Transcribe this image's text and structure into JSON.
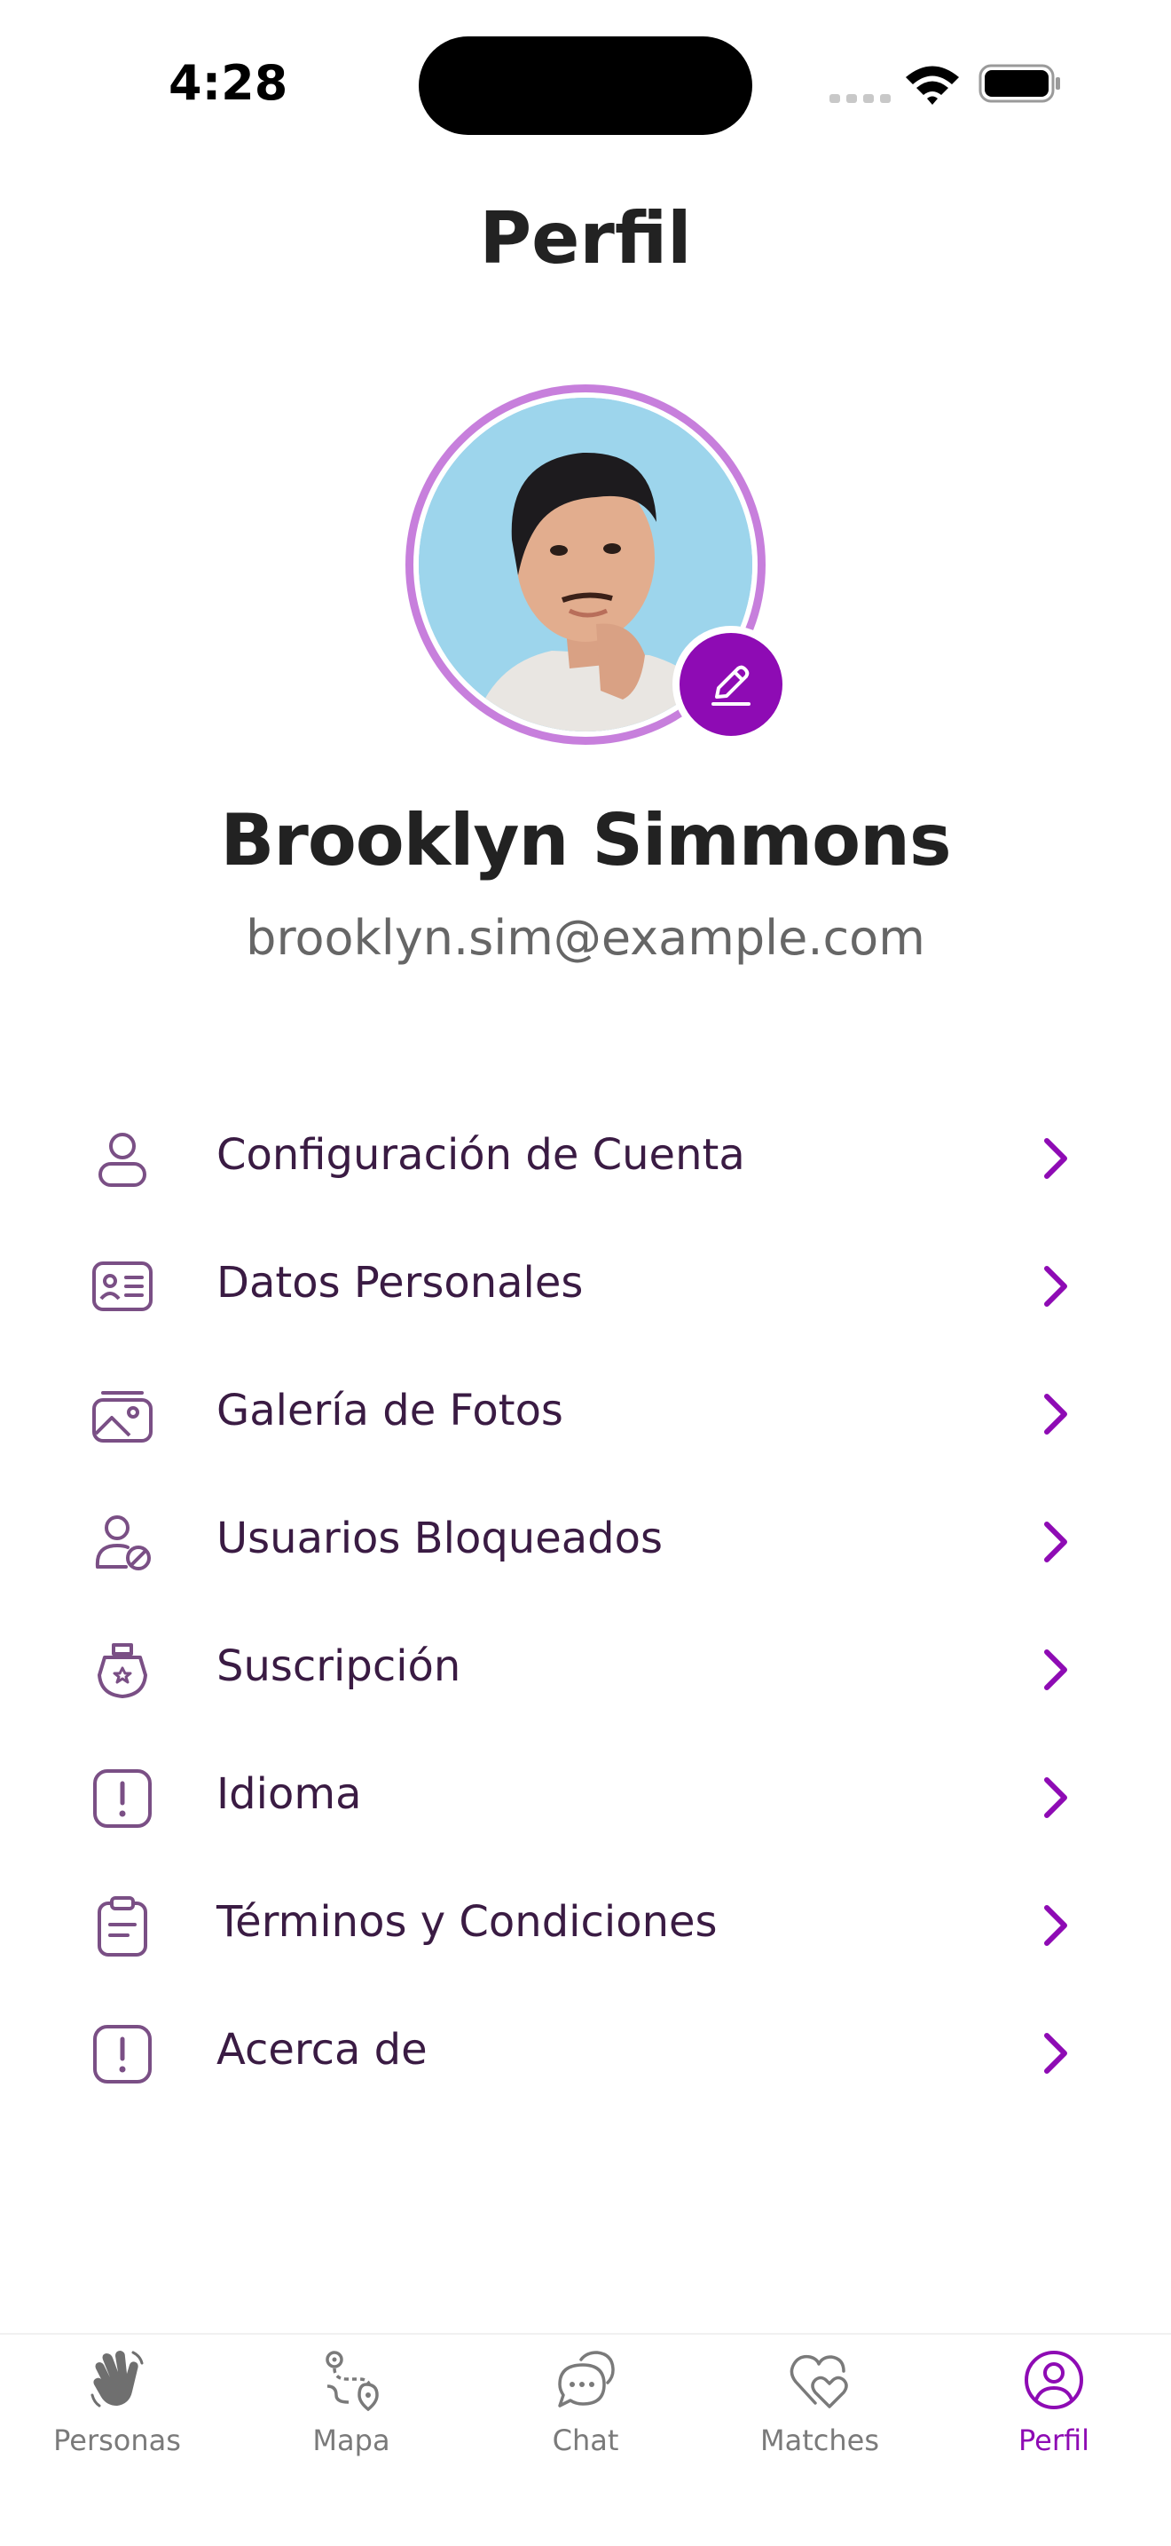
{
  "status_bar": {
    "time": "4:28"
  },
  "header": {
    "title": "Perfil"
  },
  "profile": {
    "name": "Brooklyn Simmons",
    "email": "brooklyn.sim@example.com"
  },
  "menu": [
    {
      "label": "Configuración de Cuenta",
      "icon": "user-icon"
    },
    {
      "label": "Datos Personales",
      "icon": "id-card-icon"
    },
    {
      "label": "Galería de Fotos",
      "icon": "gallery-icon"
    },
    {
      "label": "Usuarios Bloqueados",
      "icon": "user-blocked-icon"
    },
    {
      "label": "Suscripción",
      "icon": "subscription-icon"
    },
    {
      "label": "Idioma",
      "icon": "alert-icon"
    },
    {
      "label": "Términos y Condiciones",
      "icon": "clipboard-icon"
    },
    {
      "label": "Acerca de",
      "icon": "alert-icon"
    }
  ],
  "bottom_nav": [
    {
      "label": "Personas",
      "icon": "wave-hand-icon",
      "active": false
    },
    {
      "label": "Mapa",
      "icon": "route-icon",
      "active": false
    },
    {
      "label": "Chat",
      "icon": "chat-icon",
      "active": false
    },
    {
      "label": "Matches",
      "icon": "hearts-icon",
      "active": false
    },
    {
      "label": "Perfil",
      "icon": "profile-icon",
      "active": true
    }
  ],
  "colors": {
    "accent": "#8e0bb4",
    "avatar_ring": "#c77fdc",
    "menu_icon": "#7a4f85",
    "menu_text": "#3a1b43",
    "inactive_nav": "#7a7a7a"
  }
}
